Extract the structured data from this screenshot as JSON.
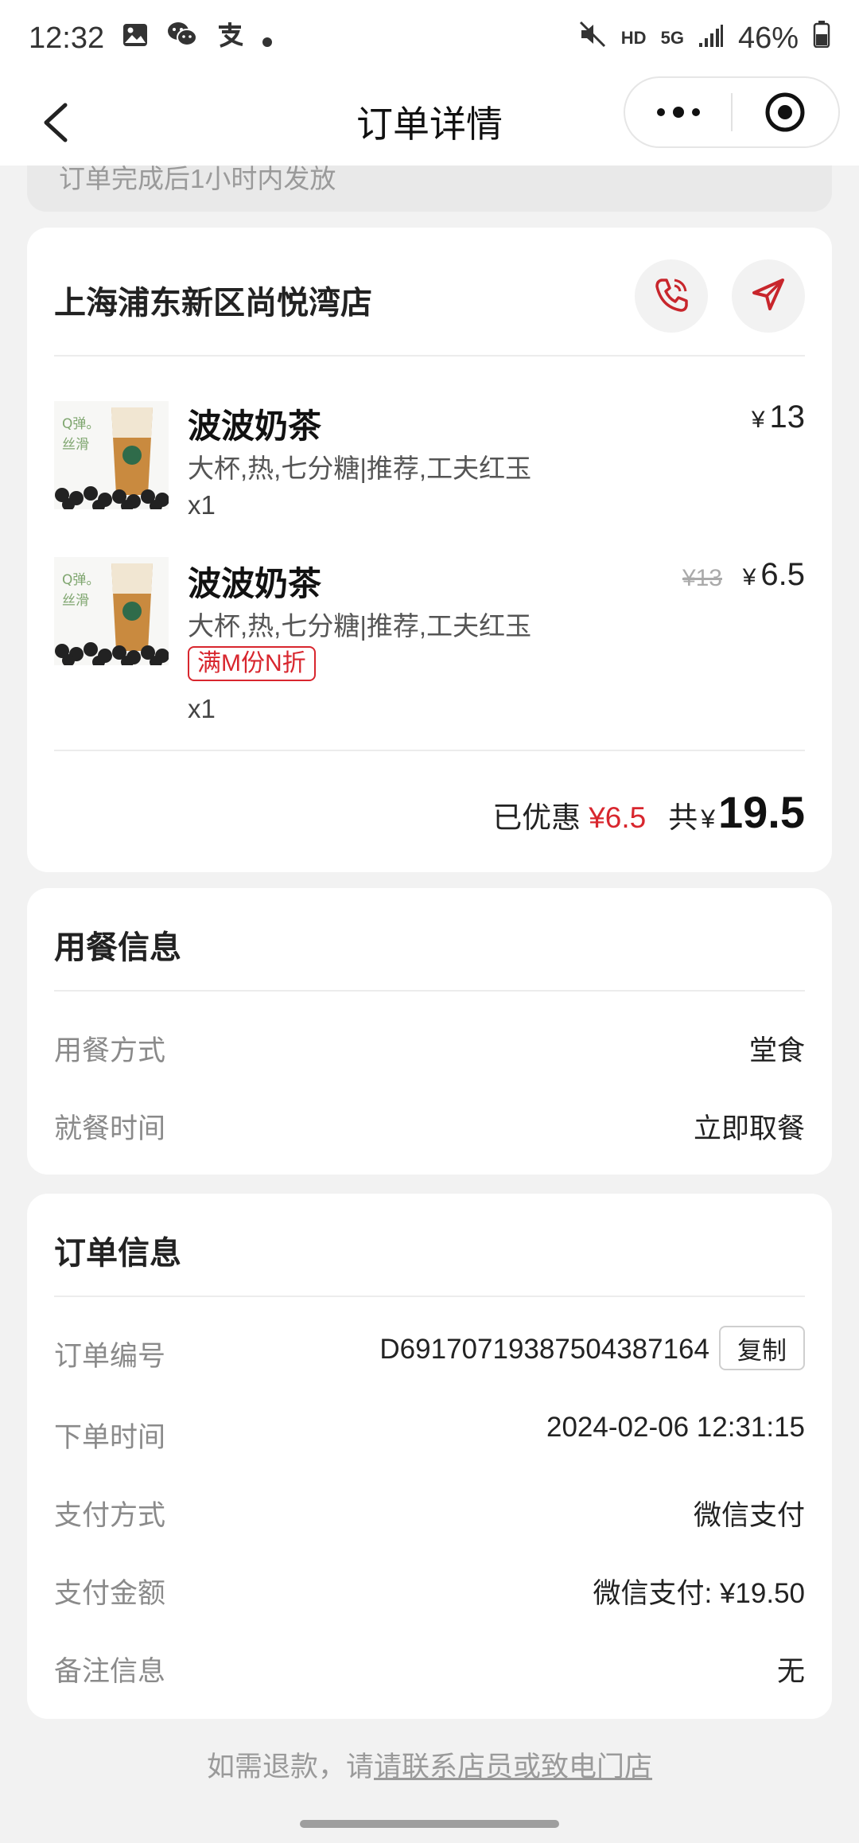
{
  "status_bar": {
    "time": "12:32",
    "left_icons": [
      "gallery-icon",
      "wechat-icon",
      "alipay-icon",
      "dot-icon"
    ],
    "hd_label": "HD",
    "network_label": "5G",
    "battery": "46%"
  },
  "nav": {
    "title": "订单详情",
    "back_icon": "back-arrow-icon",
    "more_icon": "more-dots-icon",
    "close_icon": "close-target-icon"
  },
  "notice": {
    "text": "订单完成后1小时内发放"
  },
  "store": {
    "name": "上海浦东新区尚悦湾店",
    "call_icon": "phone-icon",
    "nav_icon": "navigation-icon"
  },
  "items": [
    {
      "name": "波波奶茶",
      "options": "大杯,热,七分糖|推荐,工夫红玉",
      "qty": "x1",
      "currency": "¥",
      "price": "13",
      "image_text": "Q弹。丝滑"
    },
    {
      "name": "波波奶茶",
      "options": "大杯,热,七分糖|推荐,工夫红玉",
      "tag": "满M份N折",
      "qty": "x1",
      "old_price": "¥13",
      "currency": "¥",
      "price": "6.5",
      "image_text": "Q弹。丝滑"
    }
  ],
  "summary": {
    "discount_label": "已优惠",
    "discount_value": "¥6.5",
    "total_label": "共",
    "total_currency": "¥",
    "total_value": "19.5"
  },
  "dining": {
    "title": "用餐信息",
    "rows": [
      {
        "label": "用餐方式",
        "value": "堂食"
      },
      {
        "label": "就餐时间",
        "value": "立即取餐"
      }
    ]
  },
  "order_info": {
    "title": "订单信息",
    "order_no_label": "订单编号",
    "order_no": "D69170719387504387164",
    "copy_label": "复制",
    "rows": [
      {
        "label": "下单时间",
        "value": "2024-02-06 12:31:15"
      },
      {
        "label": "支付方式",
        "value": "微信支付"
      },
      {
        "label": "支付金额",
        "value": "微信支付: ¥19.50"
      },
      {
        "label": "备注信息",
        "value": "无"
      }
    ]
  },
  "footer": {
    "prefix": "如需退款，请",
    "link": "请联系店员或致电门店"
  },
  "colors": {
    "accent": "#d8262e",
    "page_bg": "#f2f2f2",
    "card_bg": "#ffffff"
  }
}
